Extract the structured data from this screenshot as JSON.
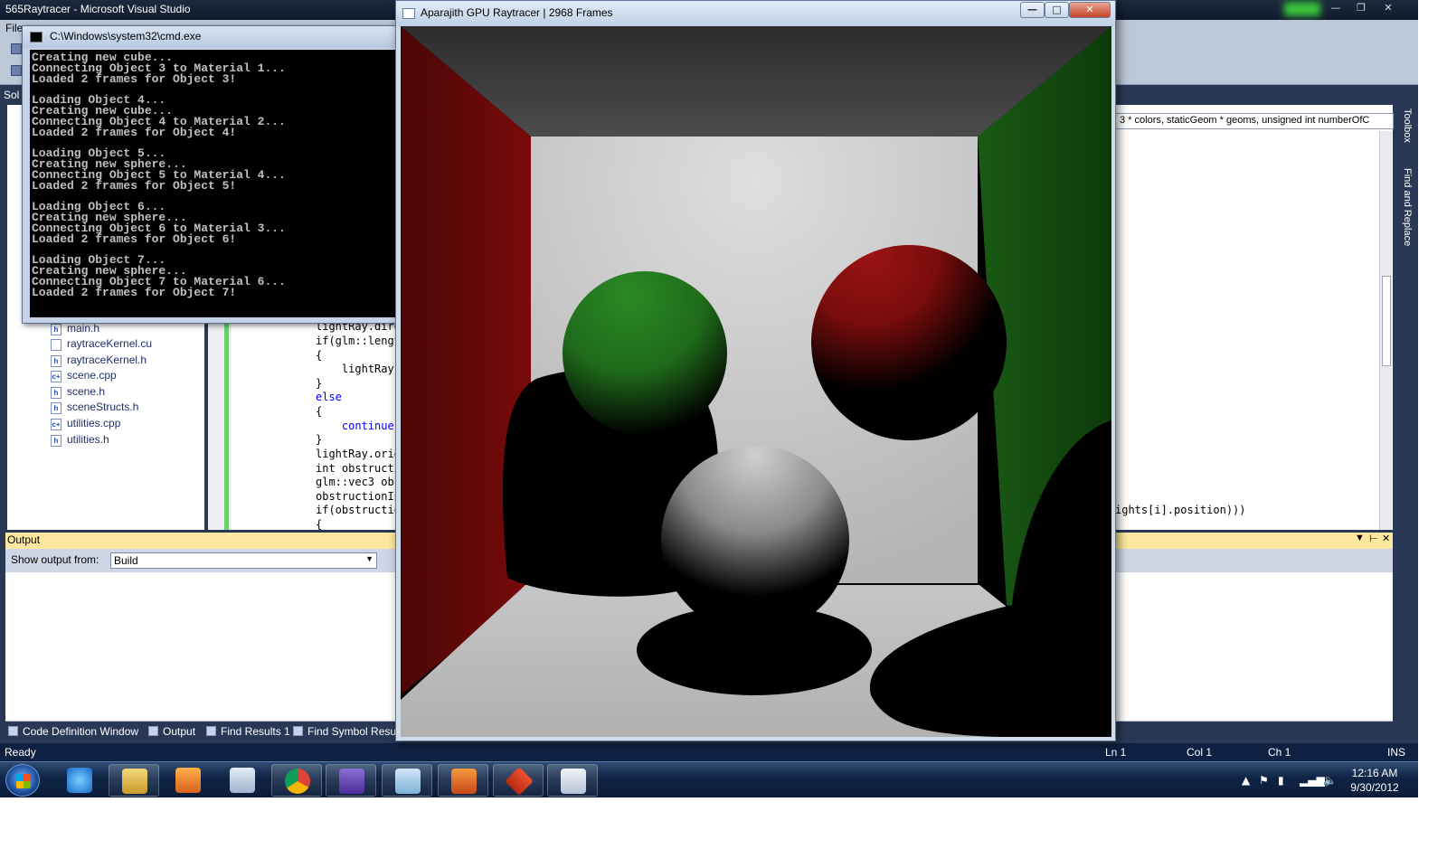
{
  "visual_studio": {
    "title": "565Raytracer - Microsoft Visual Studio",
    "menu_first": "File",
    "solution_label": "Sol",
    "solution_files": [
      {
        "name": "main.h",
        "type": "h"
      },
      {
        "name": "raytraceKernel.cu",
        "type": "cu"
      },
      {
        "name": "raytraceKernel.h",
        "type": "h"
      },
      {
        "name": "scene.cpp",
        "type": "cpp"
      },
      {
        "name": "scene.h",
        "type": "h"
      },
      {
        "name": "sceneStructs.h",
        "type": "h"
      },
      {
        "name": "utilities.cpp",
        "type": "cpp"
      },
      {
        "name": "utilities.h",
        "type": "h"
      }
    ],
    "nav_dropdown": "3 * colors, staticGeom * geoms, unsigned int numberOfC",
    "code_lines": [
      "lightRay.dire",
      "if(glm::lengt",
      "{",
      "    lightRay.",
      "}",
      "else",
      "{",
      "    continue;",
      "}",
      "lightRay.orig",
      "int obstructi",
      "glm::vec3 obs",
      "obstructionIn",
      "if(obstructio",
      "{"
    ],
    "code_right_fragment": "ights[i].position)))",
    "side_tabs": [
      "Toolbox",
      "Find and Replace"
    ],
    "output": {
      "title": "Output",
      "show_output_from_label": "Show output from:",
      "show_output_from_value": "Build"
    },
    "bottom_tabs": [
      "Code Definition Window",
      "Output",
      "Find Results 1",
      "Find Symbol Resu"
    ],
    "status": {
      "ready": "Ready",
      "ln": "Ln 1",
      "col": "Col 1",
      "ch": "Ch 1",
      "mode": "INS"
    }
  },
  "cmd_window": {
    "title": "C:\\Windows\\system32\\cmd.exe",
    "lines": [
      "Creating new cube...",
      "Connecting Object 3 to Material 1...",
      "Loaded 2 frames for Object 3!",
      "",
      "Loading Object 4...",
      "Creating new cube...",
      "Connecting Object 4 to Material 2...",
      "Loaded 2 frames for Object 4!",
      "",
      "Loading Object 5...",
      "Creating new sphere...",
      "Connecting Object 5 to Material 4...",
      "Loaded 2 frames for Object 5!",
      "",
      "Loading Object 6...",
      "Creating new sphere...",
      "Connecting Object 6 to Material 3...",
      "Loaded 2 frames for Object 6!",
      "",
      "Loading Object 7...",
      "Creating new sphere...",
      "Connecting Object 7 to Material 6...",
      "Loaded 2 frames for Object 7!"
    ]
  },
  "raytracer_window": {
    "title": "Aparajith GPU Raytracer | 2968 Frames",
    "scene_colors": {
      "left_wall": "#7a0a0a",
      "right_wall": "#1a5a14",
      "back_wall": "#d8d8d8",
      "ceiling": "#4a4a4a",
      "floor": "#cdcdcd",
      "green_sphere": "#1f6a1a",
      "red_sphere": "#7a0c0c",
      "white_sphere": "#d0d0d0"
    }
  },
  "taskbar": {
    "apps": [
      "ie-icon",
      "explorer-icon",
      "media-player-icon",
      "calculator-icon",
      "chrome-icon",
      "visual-studio-icon",
      "notepad-icon",
      "office-icon",
      "git-icon",
      "opengl-icon"
    ],
    "clock_time": "12:16 AM",
    "clock_date": "9/30/2012"
  }
}
